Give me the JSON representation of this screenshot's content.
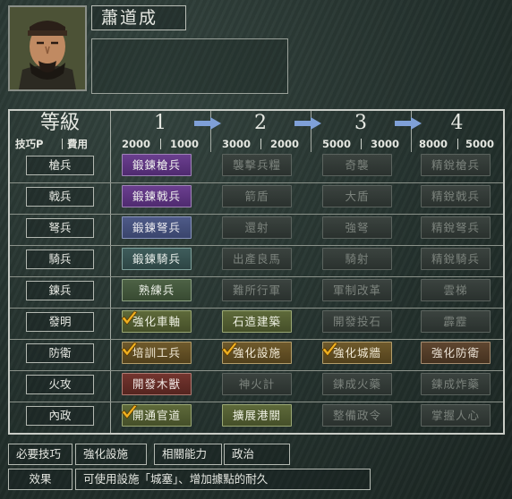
{
  "officer": {
    "name": "蕭道成",
    "portrait_icon": "officer-portrait"
  },
  "header": {
    "level_label": "等級",
    "skill_points_label": "技巧P",
    "cost_label": "費用"
  },
  "levels": [
    {
      "label": "1",
      "cost_a": "2000",
      "cost_b": "1000"
    },
    {
      "label": "2",
      "cost_a": "3000",
      "cost_b": "2000"
    },
    {
      "label": "3",
      "cost_a": "5000",
      "cost_b": "3000"
    },
    {
      "label": "4",
      "cost_a": "8000",
      "cost_b": "5000"
    }
  ],
  "rows": [
    {
      "label": "槍兵",
      "cells": [
        {
          "text": "鍛鍊槍兵",
          "style": "purple",
          "checked": false
        },
        {
          "text": "襲擊兵糧",
          "style": "dim",
          "checked": false
        },
        {
          "text": "奇襲",
          "style": "dim",
          "checked": false
        },
        {
          "text": "精銳槍兵",
          "style": "dim",
          "checked": false
        }
      ]
    },
    {
      "label": "戟兵",
      "cells": [
        {
          "text": "鍛鍊戟兵",
          "style": "purple",
          "checked": false
        },
        {
          "text": "箭盾",
          "style": "dim",
          "checked": false
        },
        {
          "text": "大盾",
          "style": "dim",
          "checked": false
        },
        {
          "text": "精銳戟兵",
          "style": "dim",
          "checked": false
        }
      ]
    },
    {
      "label": "弩兵",
      "cells": [
        {
          "text": "鍛鍊弩兵",
          "style": "blue",
          "checked": false
        },
        {
          "text": "還射",
          "style": "dim",
          "checked": false
        },
        {
          "text": "強弩",
          "style": "dim",
          "checked": false
        },
        {
          "text": "精銳弩兵",
          "style": "dim",
          "checked": false
        }
      ]
    },
    {
      "label": "騎兵",
      "cells": [
        {
          "text": "鍛鍊騎兵",
          "style": "teal",
          "checked": false
        },
        {
          "text": "出產良馬",
          "style": "dim",
          "checked": false
        },
        {
          "text": "騎射",
          "style": "dim",
          "checked": false
        },
        {
          "text": "精銳騎兵",
          "style": "dim",
          "checked": false
        }
      ]
    },
    {
      "label": "鍊兵",
      "cells": [
        {
          "text": "熟練兵",
          "style": "green",
          "checked": false
        },
        {
          "text": "難所行軍",
          "style": "dim",
          "checked": false
        },
        {
          "text": "軍制改革",
          "style": "dim",
          "checked": false
        },
        {
          "text": "雲梯",
          "style": "dim",
          "checked": false
        }
      ]
    },
    {
      "label": "發明",
      "cells": [
        {
          "text": "強化車軸",
          "style": "olive",
          "checked": true
        },
        {
          "text": "石造建築",
          "style": "olive",
          "checked": false
        },
        {
          "text": "開發投石",
          "style": "dim",
          "checked": false
        },
        {
          "text": "霹靂",
          "style": "dim",
          "checked": false
        }
      ]
    },
    {
      "label": "防衛",
      "cells": [
        {
          "text": "培訓工兵",
          "style": "gold",
          "checked": true
        },
        {
          "text": "強化設施",
          "style": "gold",
          "checked": true
        },
        {
          "text": "強化城牆",
          "style": "gold",
          "checked": true
        },
        {
          "text": "強化防衛",
          "style": "brown",
          "checked": false
        }
      ]
    },
    {
      "label": "火攻",
      "cells": [
        {
          "text": "開發木獸",
          "style": "red",
          "checked": false
        },
        {
          "text": "神火計",
          "style": "dim",
          "checked": false
        },
        {
          "text": "鍊成火藥",
          "style": "dim",
          "checked": false
        },
        {
          "text": "鍊成炸藥",
          "style": "dim",
          "checked": false
        }
      ]
    },
    {
      "label": "內政",
      "cells": [
        {
          "text": "開通官道",
          "style": "olive",
          "checked": true
        },
        {
          "text": "擴展港關",
          "style": "olive",
          "checked": false
        },
        {
          "text": "整備政令",
          "style": "dim",
          "checked": false
        },
        {
          "text": "掌握人心",
          "style": "dim",
          "checked": false
        }
      ]
    }
  ],
  "footer": {
    "required_label": "必要技巧",
    "required_value": "強化設施",
    "related_label": "相關能力",
    "related_value": "政治",
    "effect_label": "效果",
    "effect_value": "可使用設施「城塞」、增加據點的耐久"
  },
  "colors": {
    "accent_check": "#f0b020",
    "arrow": "#7fa0d8"
  }
}
